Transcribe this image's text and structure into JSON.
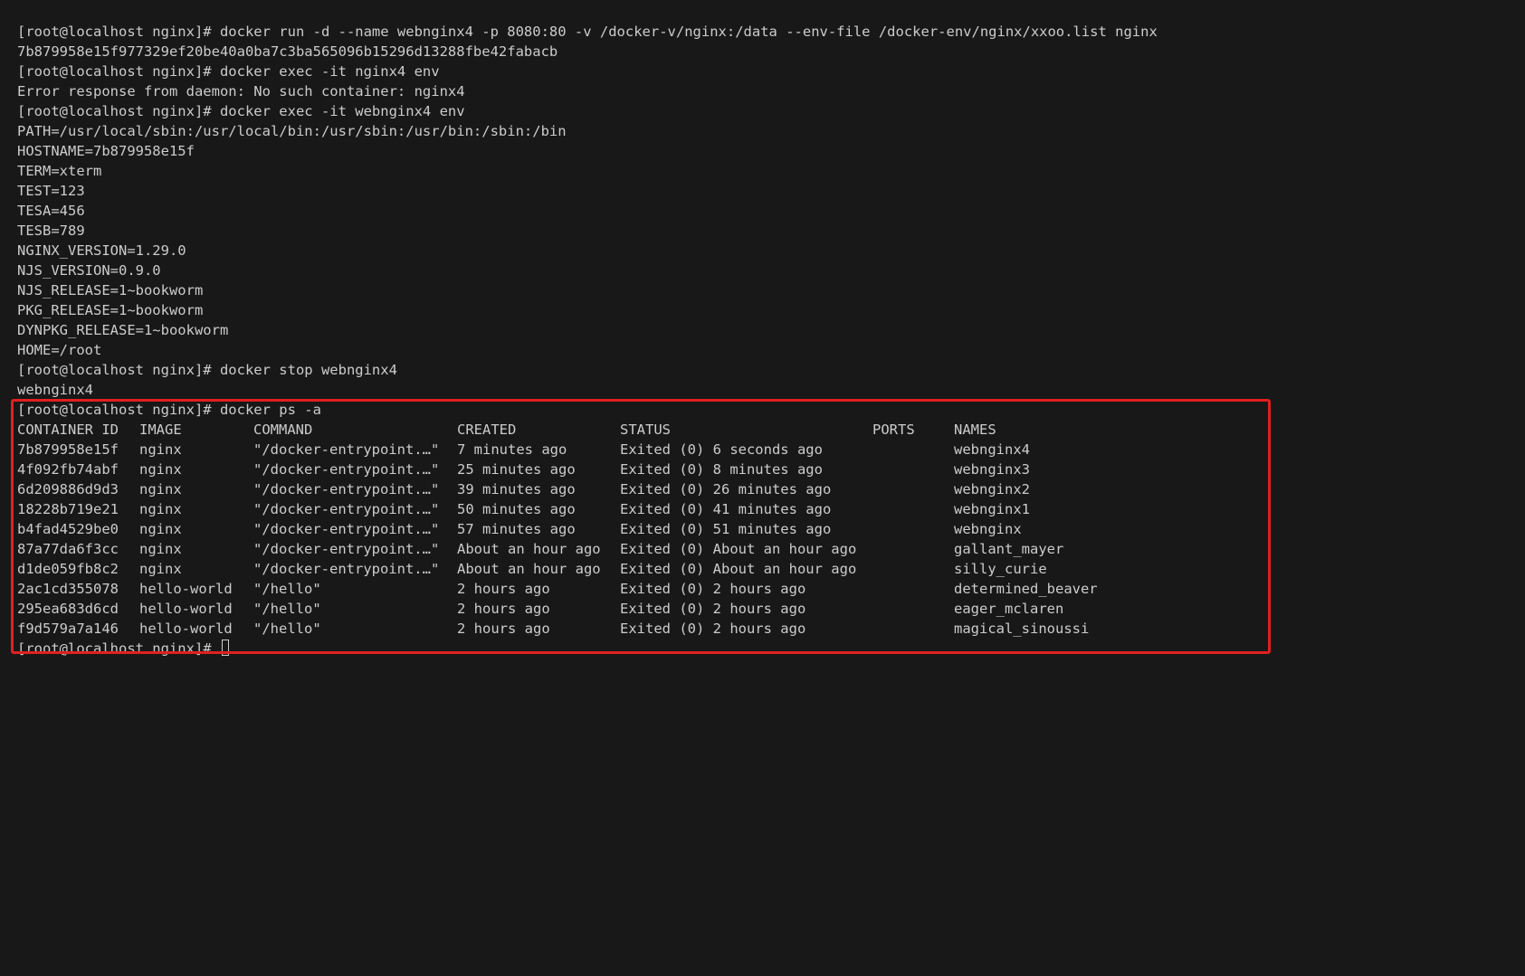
{
  "terminal": {
    "lines_before": [
      "[root@localhost nginx]# docker run -d --name webnginx4 -p 8080:80 -v /docker-v/nginx:/data --env-file /docker-env/nginx/xxoo.list nginx",
      "7b879958e15f977329ef20be40a0ba7c3ba565096b15296d13288fbe42fabacb",
      "[root@localhost nginx]# docker exec -it nginx4 env",
      "Error response from daemon: No such container: nginx4",
      "[root@localhost nginx]# docker exec -it webnginx4 env",
      "PATH=/usr/local/sbin:/usr/local/bin:/usr/sbin:/usr/bin:/sbin:/bin",
      "HOSTNAME=7b879958e15f",
      "TERM=xterm",
      "TEST=123",
      "TESA=456",
      "TESB=789",
      "NGINX_VERSION=1.29.0",
      "NJS_VERSION=0.9.0",
      "NJS_RELEASE=1~bookworm",
      "PKG_RELEASE=1~bookworm",
      "DYNPKG_RELEASE=1~bookworm",
      "HOME=/root",
      "[root@localhost nginx]# docker stop webnginx4",
      "webnginx4"
    ],
    "ps_command": "[root@localhost nginx]# docker ps -a",
    "table": {
      "headers": {
        "id": "CONTAINER ID",
        "image": "IMAGE",
        "command": "COMMAND",
        "created": "CREATED",
        "status": "STATUS",
        "ports": "PORTS",
        "names": "NAMES"
      },
      "rows": [
        {
          "id": "7b879958e15f",
          "image": "nginx",
          "command": "\"/docker-entrypoint.…\"",
          "created": "7 minutes ago",
          "status": "Exited (0) 6 seconds ago",
          "ports": "",
          "names": "webnginx4"
        },
        {
          "id": "4f092fb74abf",
          "image": "nginx",
          "command": "\"/docker-entrypoint.…\"",
          "created": "25 minutes ago",
          "status": "Exited (0) 8 minutes ago",
          "ports": "",
          "names": "webnginx3"
        },
        {
          "id": "6d209886d9d3",
          "image": "nginx",
          "command": "\"/docker-entrypoint.…\"",
          "created": "39 minutes ago",
          "status": "Exited (0) 26 minutes ago",
          "ports": "",
          "names": "webnginx2"
        },
        {
          "id": "18228b719e21",
          "image": "nginx",
          "command": "\"/docker-entrypoint.…\"",
          "created": "50 minutes ago",
          "status": "Exited (0) 41 minutes ago",
          "ports": "",
          "names": "webnginx1"
        },
        {
          "id": "b4fad4529be0",
          "image": "nginx",
          "command": "\"/docker-entrypoint.…\"",
          "created": "57 minutes ago",
          "status": "Exited (0) 51 minutes ago",
          "ports": "",
          "names": "webnginx"
        },
        {
          "id": "87a77da6f3cc",
          "image": "nginx",
          "command": "\"/docker-entrypoint.…\"",
          "created": "About an hour ago",
          "status": "Exited (0) About an hour ago",
          "ports": "",
          "names": "gallant_mayer"
        },
        {
          "id": "d1de059fb8c2",
          "image": "nginx",
          "command": "\"/docker-entrypoint.…\"",
          "created": "About an hour ago",
          "status": "Exited (0) About an hour ago",
          "ports": "",
          "names": "silly_curie"
        },
        {
          "id": "2ac1cd355078",
          "image": "hello-world",
          "command": "\"/hello\"",
          "created": "2 hours ago",
          "status": "Exited (0) 2 hours ago",
          "ports": "",
          "names": "determined_beaver"
        },
        {
          "id": "295ea683d6cd",
          "image": "hello-world",
          "command": "\"/hello\"",
          "created": "2 hours ago",
          "status": "Exited (0) 2 hours ago",
          "ports": "",
          "names": "eager_mclaren"
        },
        {
          "id": "f9d579a7a146",
          "image": "hello-world",
          "command": "\"/hello\"",
          "created": "2 hours ago",
          "status": "Exited (0) 2 hours ago",
          "ports": "",
          "names": "magical_sinoussi"
        }
      ]
    },
    "final_prompt": "[root@localhost nginx]#",
    "colors": {
      "background": "#181818",
      "foreground": "#cccccc",
      "highlight_border": "#e02020"
    }
  }
}
